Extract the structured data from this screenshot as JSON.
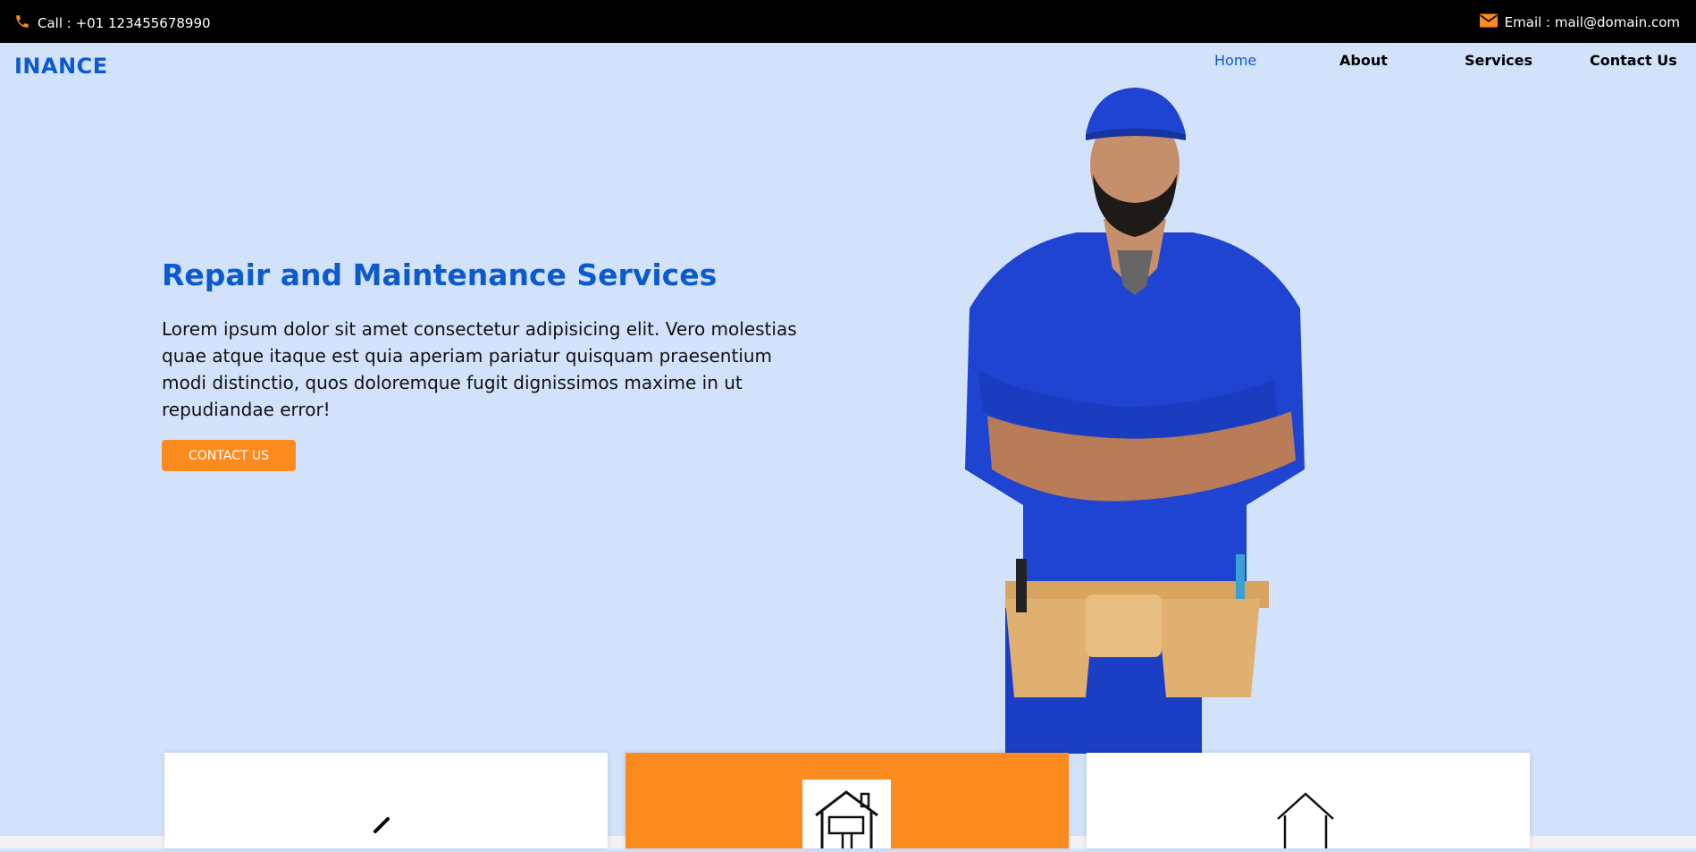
{
  "topbar": {
    "call_text": "Call : +01 123455678990",
    "email_text": "Email : mail@domain.com",
    "phone_icon": "phone-icon",
    "mail_icon": "envelope-icon"
  },
  "brand": {
    "logo": "INANCE"
  },
  "nav": {
    "items": [
      {
        "label": "Home",
        "active": true
      },
      {
        "label": "About",
        "active": false
      },
      {
        "label": "Services",
        "active": false
      },
      {
        "label": "Contact Us",
        "active": false
      }
    ]
  },
  "hero": {
    "title": "Repair and Maintenance Services",
    "text": "Lorem ipsum dolor sit amet consectetur adipisicing elit. Vero molestias quae atque itaque est quia aperiam pariatur quisquam praesentium modi distinctio, quos doloremque fugit dignissimos maxime in ut repudiandae error!",
    "cta_label": "CONTACT US"
  },
  "services": {
    "cards": [
      {
        "icon": "paintbrush-icon",
        "style": "white"
      },
      {
        "icon": "house-repair-icon",
        "style": "orange"
      },
      {
        "icon": "house-icon",
        "style": "white"
      }
    ]
  },
  "colors": {
    "accent": "#0c5acd",
    "orange": "#fb8b1e",
    "hero_bg": "#d2e2fb",
    "topbar_bg": "#000000"
  }
}
